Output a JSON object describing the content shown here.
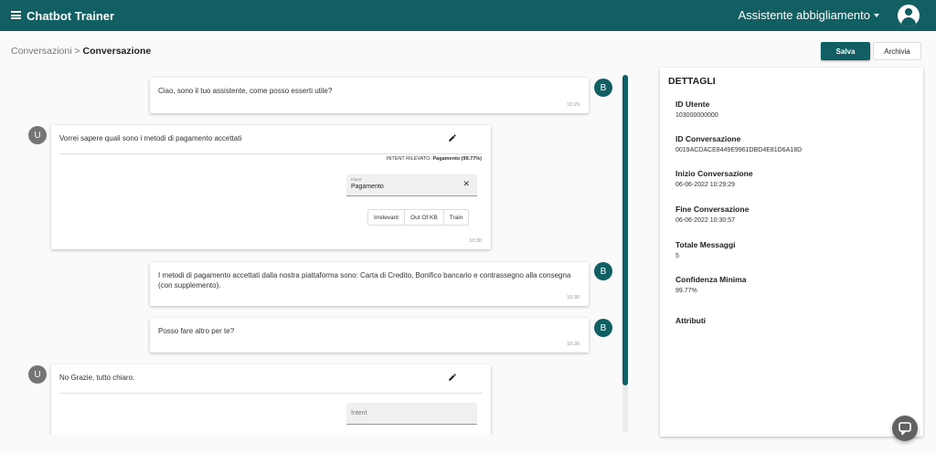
{
  "header": {
    "title": "Chatbot Trainer",
    "bot_selector": "Assistente abbigliamento"
  },
  "breadcrumb": {
    "parent": "Conversazioni",
    "separator": " > ",
    "current": "Conversazione"
  },
  "actions": {
    "save_label": "Salva",
    "archive_label": "Archivia"
  },
  "messages": [
    {
      "sender": "bot",
      "avatar": "B",
      "text": "Ciao, sono il tuo assistente, come posso esserti utile?",
      "time": "10:29"
    },
    {
      "sender": "user",
      "avatar": "U",
      "text": "Vorrei sapere quali sono i metodi di pagamento accettati",
      "intent_detected_label": "INTENT RILEVATO:",
      "intent_detected_value": "Pagamento (99.77%)",
      "intent_label": "Intent",
      "intent_value": "Pagamento",
      "buttons": [
        "Irrelevant",
        "Out Of KB",
        "Train"
      ],
      "time": "10:30"
    },
    {
      "sender": "bot",
      "avatar": "B",
      "text": "I metodi di pagamento accettati dalla nostra piattaforma sono: Carta di Credito, Bonifico bancario e contrassegno alla consegna (con supplemento).",
      "time": "10:30"
    },
    {
      "sender": "bot",
      "avatar": "B",
      "text": "Posso fare altro per te?",
      "time": "10:30"
    },
    {
      "sender": "user",
      "avatar": "U",
      "text": "No Grazie, tutto chiaro.",
      "intent_placeholder": "Intent"
    }
  ],
  "details": {
    "title": "DETTAGLI",
    "fields": [
      {
        "label": "ID Utente",
        "value": "103000000000"
      },
      {
        "label": "ID Conversazione",
        "value": "0019ACDACE8449E9961DBD4E81D6A18D"
      },
      {
        "label": "Inizio Conversazione",
        "value": "06-06-2022 10:29:29"
      },
      {
        "label": "Fine Conversazione",
        "value": "06-06-2022 10:30:57"
      },
      {
        "label": "Totale Messaggi",
        "value": "5"
      },
      {
        "label": "Confidenza Minima",
        "value": "99.77%"
      },
      {
        "label": "Attributi",
        "value": ""
      }
    ]
  },
  "icons": {
    "menu": "menu-icon",
    "account": "account-circle-icon",
    "edit": "pencil-icon",
    "clear": "close-icon",
    "feedback": "chat-bubble-icon"
  },
  "colors": {
    "primary": "#115e63",
    "user_avatar": "#757575",
    "fab": "#616161"
  }
}
